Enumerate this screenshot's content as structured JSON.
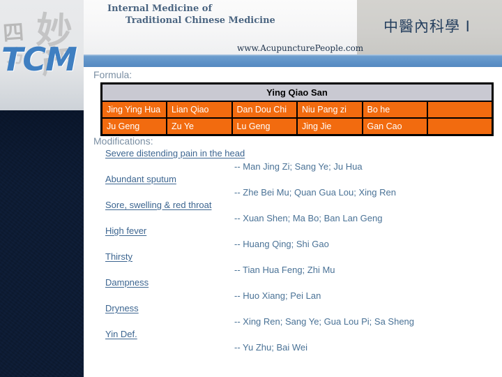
{
  "header": {
    "title_line1": "Internal Medicine of",
    "title_line2": "Traditional Chinese Medicine",
    "site_url": "www.AcupuncturePeople.com",
    "title_cn": "中醫內科學 I",
    "logo": "TCM",
    "calligraphy": [
      "四",
      "妙",
      "产",
      "方"
    ]
  },
  "content": {
    "formula_label": "Formula:",
    "modifications_label": "Modifications:"
  },
  "formula_table": {
    "title": "Ying Qiao San",
    "rows": [
      [
        "Jing Ying Hua",
        "Lian Qiao",
        "Dan Dou Chi",
        "Niu Pang zi",
        "Bo he",
        ""
      ],
      [
        "Ju Geng",
        "Zu Ye",
        "Lu Geng",
        "Jing Jie",
        "Gan Cao",
        ""
      ]
    ]
  },
  "modifications": [
    {
      "term": "Severe distending pain in the head",
      "value": "-- Man Jing Zi; Sang Ye; Ju Hua"
    },
    {
      "term": "Abundant sputum",
      "value": "-- Zhe Bei Mu; Quan Gua Lou; Xing Ren"
    },
    {
      "term": "Sore, swelling & red throat",
      "value": "-- Xuan Shen; Ma Bo; Ban Lan Geng"
    },
    {
      "term": "High fever",
      "value": "-- Huang Qing; Shi Gao"
    },
    {
      "term": "Thirsty",
      "value": "-- Tian Hua Feng; Zhi Mu"
    },
    {
      "term": "Dampness",
      "value": "-- Huo Xiang; Pei Lan"
    },
    {
      "term": "Dryness",
      "value": "-- Xing Ren; Sang Ye; Gua Lou Pi; Sa Sheng"
    },
    {
      "term": "Yin Def.",
      "value": "-- Yu Zhu; Bai Wei"
    }
  ],
  "colors": {
    "table_cell_orange": "#f26b0f",
    "table_header_gray": "#c9c9d2",
    "banner_blue": "#5f93c8",
    "label_gray_blue": "#7b8fa3",
    "link_blue": "#3c6590",
    "value_blue": "#4a7296",
    "logo_blue": "#3f7fc1"
  }
}
